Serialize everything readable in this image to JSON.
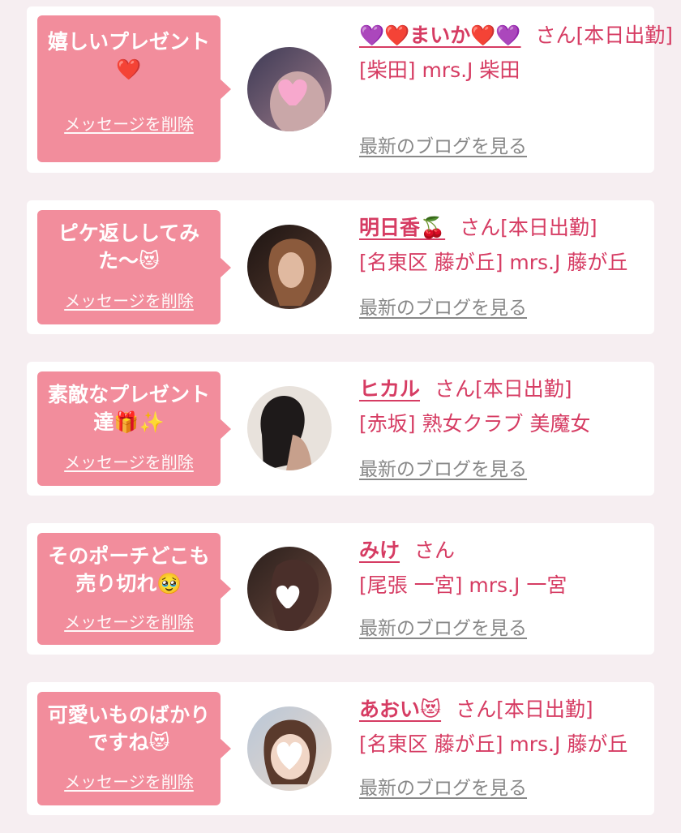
{
  "colors": {
    "accent": "#d63c63",
    "bubble": "#f28d9c",
    "muted": "#888888",
    "page_bg": "#f6eef1"
  },
  "cards": [
    {
      "message": "嬉しいプレゼント❤️",
      "delete_label": "メッセージを削除",
      "name": "💜❤️まいか❤️💜",
      "name_suffix": "さん",
      "status": "[本日出勤]",
      "shop": "[柴田] mrs.J 柴田",
      "blog_label": "最新のブログを見る"
    },
    {
      "message": "ピケ返ししてみた〜😻",
      "delete_label": "メッセージを削除",
      "name": "明日香🍒",
      "name_suffix": "さん",
      "status": "[本日出勤]",
      "shop": "[名東区 藤が丘] mrs.J 藤が丘",
      "blog_label": "最新のブログを見る"
    },
    {
      "message": "素敵なプレゼント達🎁✨",
      "delete_label": "メッセージを削除",
      "name": "ヒカル",
      "name_suffix": "さん",
      "status": "[本日出勤]",
      "shop": "[赤坂] 熟女クラブ 美魔女",
      "blog_label": "最新のブログを見る"
    },
    {
      "message": "そのポーチどこも売り切れ🥹",
      "delete_label": "メッセージを削除",
      "name": "みけ",
      "name_suffix": "さん",
      "status": "",
      "shop": "[尾張 一宮] mrs.J 一宮",
      "blog_label": "最新のブログを見る"
    },
    {
      "message": "可愛いものばかりですね😻",
      "delete_label": "メッセージを削除",
      "name": "あおい😻",
      "name_suffix": "さん",
      "status": "[本日出勤]",
      "shop": "[名東区 藤が丘] mrs.J 藤が丘",
      "blog_label": "最新のブログを見る"
    }
  ]
}
